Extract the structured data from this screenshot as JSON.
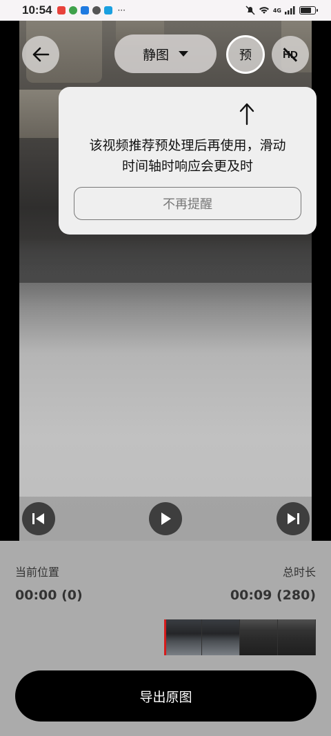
{
  "status_bar": {
    "time": "10:54",
    "app_icon_colors": [
      "#e8413a",
      "#3fa14a",
      "#1f7ae0",
      "#555555",
      "#1aa0e0"
    ],
    "more": "···",
    "network_label": "4G"
  },
  "toolbar": {
    "back_icon": "arrow-left-icon",
    "mode_label": "静图",
    "preprocess_label": "预",
    "hd_label": "HD"
  },
  "tooltip": {
    "message_line1": "该视频推荐预处理后再使用，滑动",
    "message_line2": "时间轴时响应会更及时",
    "dismiss_label": "不再提醒"
  },
  "playback": {
    "prev_icon": "step-backward-icon",
    "play_icon": "play-icon",
    "next_icon": "step-forward-icon"
  },
  "info": {
    "current_label": "当前位置",
    "current_value": "00:00 (0)",
    "total_label": "总时长",
    "total_value": "00:09 (280)"
  },
  "timeline": {
    "progress": 0
  },
  "export": {
    "label": "导出原图"
  },
  "colors": {
    "playhead": "#d51c1c",
    "panel_bg": "#ababab",
    "export_bg": "#000000"
  }
}
